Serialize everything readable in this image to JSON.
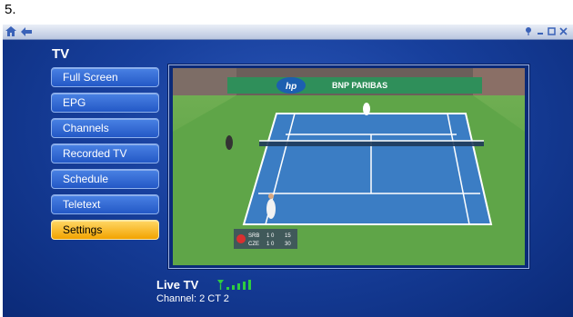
{
  "step": "5.",
  "title": "TV",
  "menu": [
    {
      "label": "Full Screen",
      "active": false
    },
    {
      "label": "EPG",
      "active": false
    },
    {
      "label": "Channels",
      "active": false
    },
    {
      "label": "Recorded TV",
      "active": false
    },
    {
      "label": "Schedule",
      "active": false
    },
    {
      "label": "Teletext",
      "active": false
    },
    {
      "label": "Settings",
      "active": true
    }
  ],
  "video": {
    "banner_text": "BNP PARIBAS",
    "sponsor": "hp",
    "scoreboard": {
      "rows": [
        {
          "team": "SRB",
          "sets": "1 0",
          "points": "15"
        },
        {
          "team": "CZE",
          "sets": "1 0",
          "points": "30"
        }
      ]
    }
  },
  "status": {
    "live_label": "Live TV",
    "channel_label": "Channel: 2 CT 2",
    "signal_level": 4
  },
  "colors": {
    "accent_active": "#f2a300",
    "menu_blue": "#2358c6",
    "background": "#173f9c",
    "signal": "#2ecc40"
  },
  "icons": {
    "home": "home-icon",
    "back": "back-arrow-icon",
    "minimize": "minimize-icon",
    "restore": "restore-icon",
    "close": "close-icon",
    "signal": "signal-strength-icon"
  }
}
